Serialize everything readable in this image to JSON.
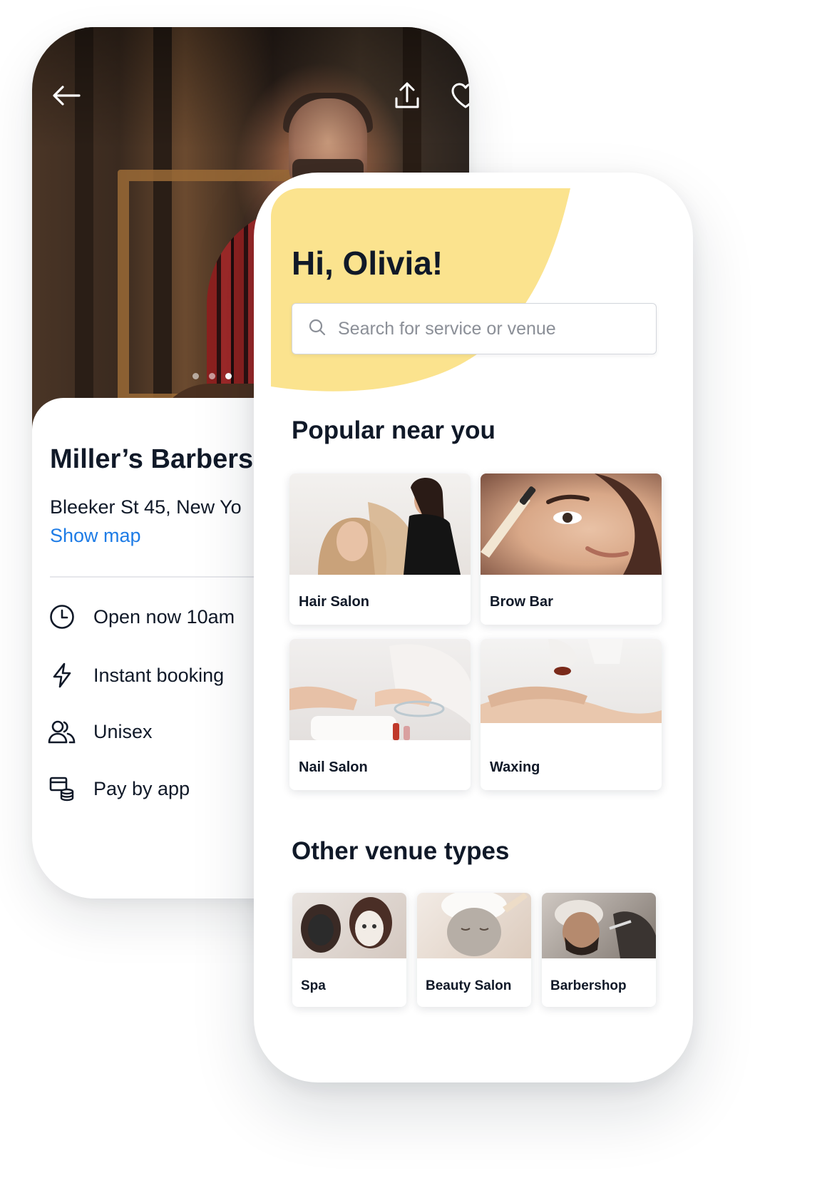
{
  "venue_detail": {
    "name": "Miller’s Barbers",
    "address": "Bleeker St 45, New Yo",
    "show_map_label": "Show map",
    "features": [
      {
        "icon": "clock-icon",
        "label": "Open now 10am"
      },
      {
        "icon": "lightning-icon",
        "label": "Instant booking"
      },
      {
        "icon": "users-icon",
        "label": "Unisex"
      },
      {
        "icon": "pay-by-app-icon",
        "label": "Pay by app"
      }
    ],
    "header_icons": [
      "back-arrow-icon",
      "share-icon",
      "heart-icon"
    ],
    "carousel": {
      "count": 3,
      "active": 3
    }
  },
  "home": {
    "greeting": "Hi, Olivia!",
    "search": {
      "placeholder": "Search for service or venue"
    },
    "popular_title": "Popular near you",
    "popular": [
      {
        "label": "Hair Salon"
      },
      {
        "label": "Brow Bar"
      },
      {
        "label": "Nail Salon"
      },
      {
        "label": "Waxing"
      }
    ],
    "other_title": "Other venue types",
    "other": [
      {
        "label": "Spa"
      },
      {
        "label": "Beauty Salon"
      },
      {
        "label": "Barbershop"
      }
    ]
  },
  "colors": {
    "accent_yellow": "#fbe38e",
    "link_blue": "#1e7ce6",
    "text_dark": "#101928"
  }
}
